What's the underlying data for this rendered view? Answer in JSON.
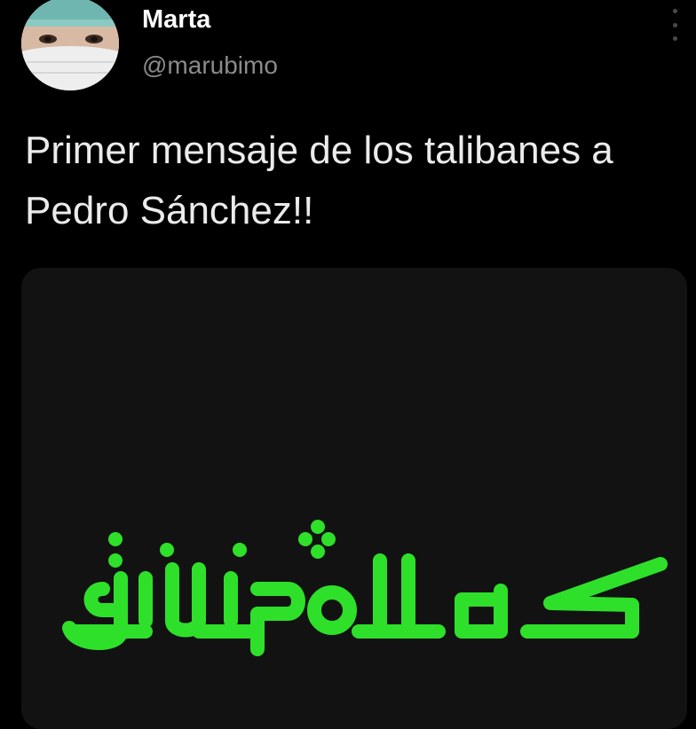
{
  "author": {
    "name": "Marta",
    "handle": "@marubimo"
  },
  "tweet": {
    "text": "Primer mensaje de los talibanes a Pedro Sánchez!!"
  },
  "media": {
    "caption_text": "gilipollas",
    "caption_color": "#2ee02a",
    "background": "#121212"
  },
  "icons": {
    "more": "more-vertical-icon"
  }
}
